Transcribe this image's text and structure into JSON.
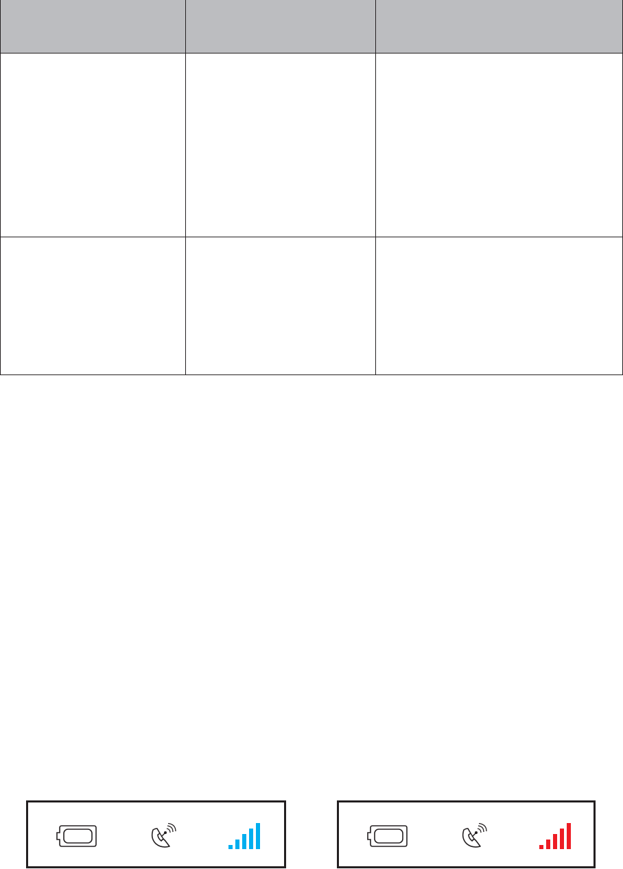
{
  "table": {
    "header": [
      "",
      "",
      ""
    ],
    "rows": [
      [
        "",
        "",
        ""
      ],
      [
        "",
        "",
        ""
      ]
    ],
    "header_bg": "#bcbdc0",
    "line_color": "#231f20"
  },
  "indicator_panels": [
    {
      "icons": [
        "battery-icon",
        "gps-satellite-icon",
        "signal-strength-icon"
      ],
      "signal_bars": 5,
      "signal_color": "#00aeef"
    },
    {
      "icons": [
        "battery-icon",
        "gps-satellite-icon",
        "signal-strength-icon"
      ],
      "signal_bars": 5,
      "signal_color": "#ed1c24"
    }
  ]
}
